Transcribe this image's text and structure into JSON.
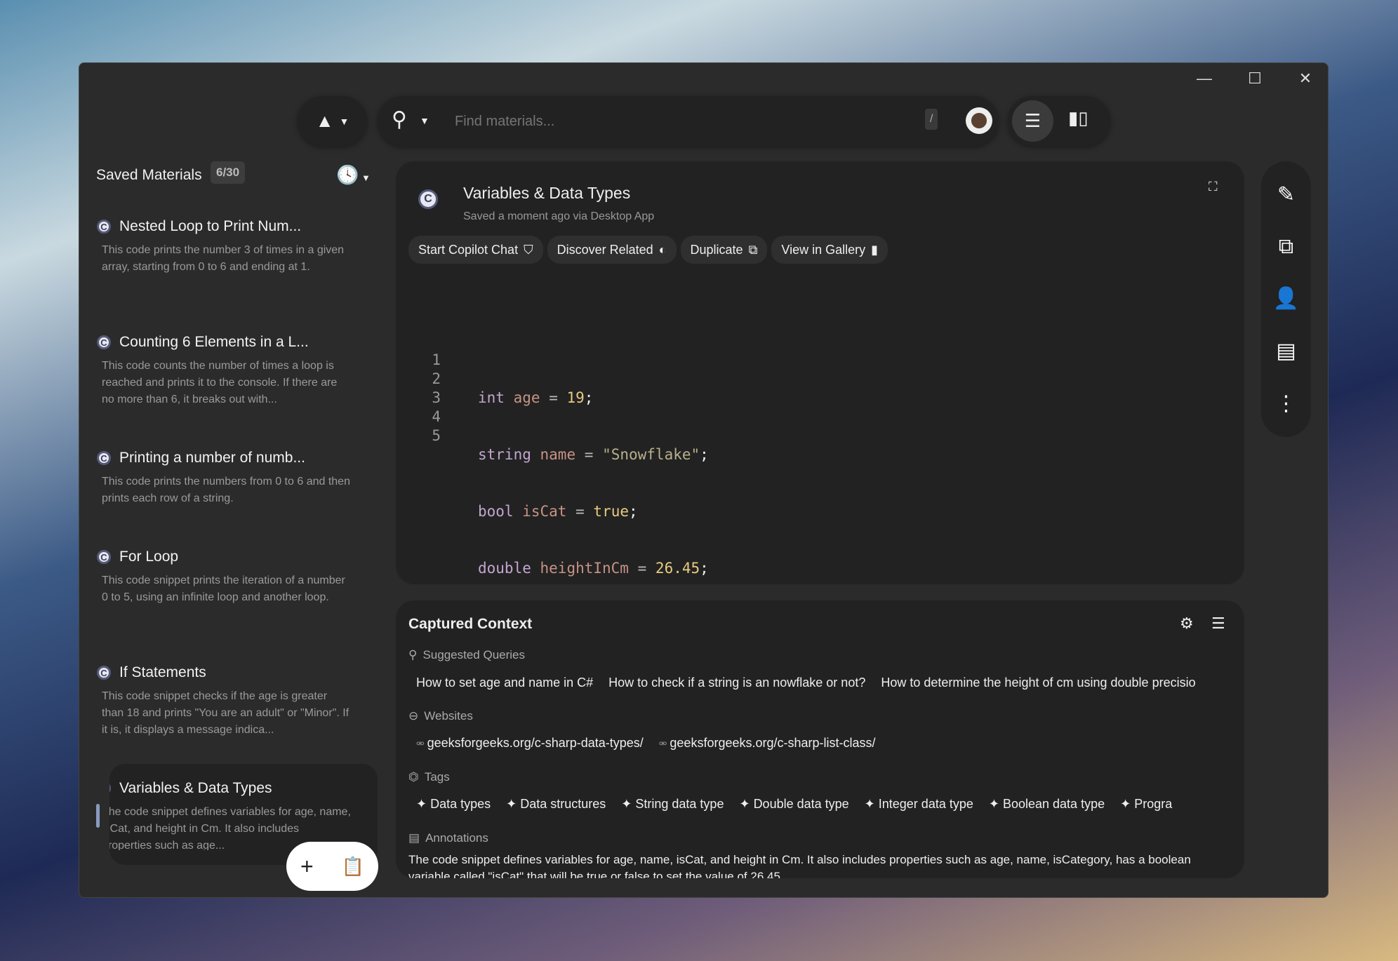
{
  "window": {
    "minimize": "—",
    "maximize": "☐",
    "close": "✕"
  },
  "toolbar": {
    "search_placeholder": "Find materials...",
    "shortcut": "/"
  },
  "sidebar": {
    "title": "Saved Materials",
    "count": "6/30",
    "items": [
      {
        "title": "Nested Loop to Print Num...",
        "desc": "This code prints the number 3 of times in a given array, starting from 0 to 6 and ending at 1."
      },
      {
        "title": "Counting 6 Elements in a L...",
        "desc": "This code counts the number of times a loop is reached and prints it to the console. If there are no more than 6, it breaks out with..."
      },
      {
        "title": "Printing a number of numb...",
        "desc": "This code prints the numbers from 0 to 6 and then prints each row of a string."
      },
      {
        "title": "For Loop",
        "desc": "This code snippet prints the iteration of a number 0 to 5, using an infinite loop and another loop."
      },
      {
        "title": "If Statements",
        "desc": "This code snippet checks if the age is greater than 18 and prints \"You are an adult\" or \"Minor\". If it is, it displays a message indica..."
      },
      {
        "title": "Variables & Data Types",
        "desc": "The code snippet defines variables for age, name, isCat, and height in Cm. It also includes properties such as age..."
      }
    ],
    "fab_add": "+"
  },
  "material": {
    "title": "Variables & Data Types",
    "subtitle": "Saved a moment ago via Desktop App",
    "actions": [
      "Start Copilot Chat",
      "Discover Related",
      "Duplicate",
      "View in Gallery"
    ],
    "line_numbers": [
      "1",
      "2",
      "3",
      "4",
      "5"
    ]
  },
  "context": {
    "title": "Captured Context",
    "queries_label": "Suggested Queries",
    "queries": [
      "How to set age and name in C#",
      "How to check if a string is an nowflake or not?",
      "How to determine the height of cm using double precisio"
    ],
    "websites_label": "Websites",
    "websites": [
      "geeksforgeeks.org/c-sharp-data-types/",
      "geeksforgeeks.org/c-sharp-list-class/"
    ],
    "tags_label": "Tags",
    "tags": [
      "Data types",
      "Data structures",
      "String data type",
      "Double data type",
      "Integer data type",
      "Boolean data type",
      "Progra"
    ],
    "annotations_label": "Annotations",
    "annotation": "The code snippet defines variables for age, name, isCat, and height in Cm. It also includes properties such as age, name, isCategory, has a boolean variable called \"isCat\" that will be true or false to set the value of 26.45"
  },
  "colors": {
    "keyword": "#c2a6d0",
    "variable": "#c69384",
    "number": "#e8cb80",
    "string": "#b7b08c"
  }
}
